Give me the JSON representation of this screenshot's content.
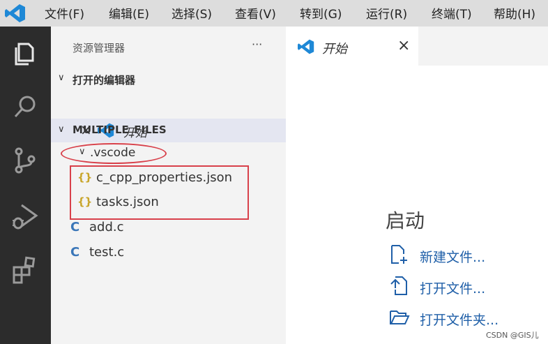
{
  "menubar": {
    "items": [
      "文件(F)",
      "编辑(E)",
      "选择(S)",
      "查看(V)",
      "转到(G)",
      "运行(R)",
      "终端(T)",
      "帮助(H)"
    ]
  },
  "sidebar": {
    "title": "资源管理器",
    "more": "···",
    "open_editors_header": "打开的编辑器",
    "open_editor_close": "×",
    "open_editor_label": "开始",
    "folder_header": "MULTIPLE_FILES",
    "folder_vscode": ".vscode",
    "files": [
      {
        "icon": "{}",
        "name": "c_cpp_properties.json"
      },
      {
        "icon": "{}",
        "name": "tasks.json"
      },
      {
        "icon": "C",
        "name": "add.c"
      },
      {
        "icon": "C",
        "name": "test.c"
      }
    ]
  },
  "editor": {
    "tab_label": "开始",
    "tab_close": "×",
    "start_heading": "启动",
    "actions": [
      "新建文件...",
      "打开文件...",
      "打开文件夹..."
    ]
  },
  "watermark": "CSDN @GIS儿",
  "colors": {
    "vscode_blue": "#1e88d6",
    "json_icon": "#c8a52a",
    "c_icon": "#3a76b8",
    "annotation_red": "#d8404a"
  }
}
